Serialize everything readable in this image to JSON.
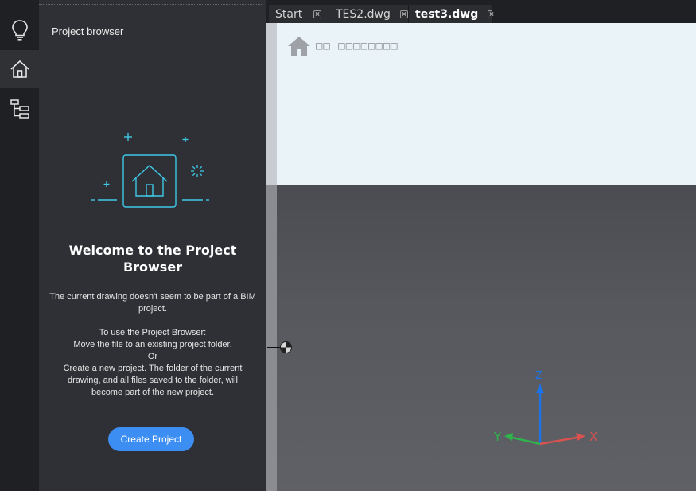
{
  "rail": {
    "items": [
      {
        "icon": "lightbulb-icon",
        "active": false
      },
      {
        "icon": "home-icon",
        "active": true
      },
      {
        "icon": "tree-structure-icon",
        "active": false
      }
    ]
  },
  "panel": {
    "title": "Project browser",
    "welcome_title": "Welcome to the Project Browser",
    "message_line1": "The current drawing doesn't seem to be part of a BIM project.",
    "message_line2": "To use the Project Browser:",
    "message_line3": "Move the file to an existing project folder.",
    "message_line4": "Or",
    "message_line5": "Create a new project. The folder of the current drawing, and all files saved to the folder, will become part of the new project.",
    "create_button": "Create Project",
    "accent_color": "#3fc8e6"
  },
  "tabs": [
    {
      "label": "Start",
      "active": false
    },
    {
      "label": "TES2.dwg",
      "active": false
    },
    {
      "label": "test3.dwg",
      "active": true
    }
  ],
  "sheet": {
    "label": "□□ □□□□□□□□"
  },
  "ucs": {
    "x_label": "X",
    "y_label": "Y",
    "z_label": "Z",
    "x_color": "#d8534f",
    "y_color": "#2fb34a",
    "z_color": "#1a73e8"
  },
  "colors": {
    "button_blue": "#3d8ef2",
    "rail_bg": "#1f2023",
    "panel_bg": "#2e3035"
  }
}
